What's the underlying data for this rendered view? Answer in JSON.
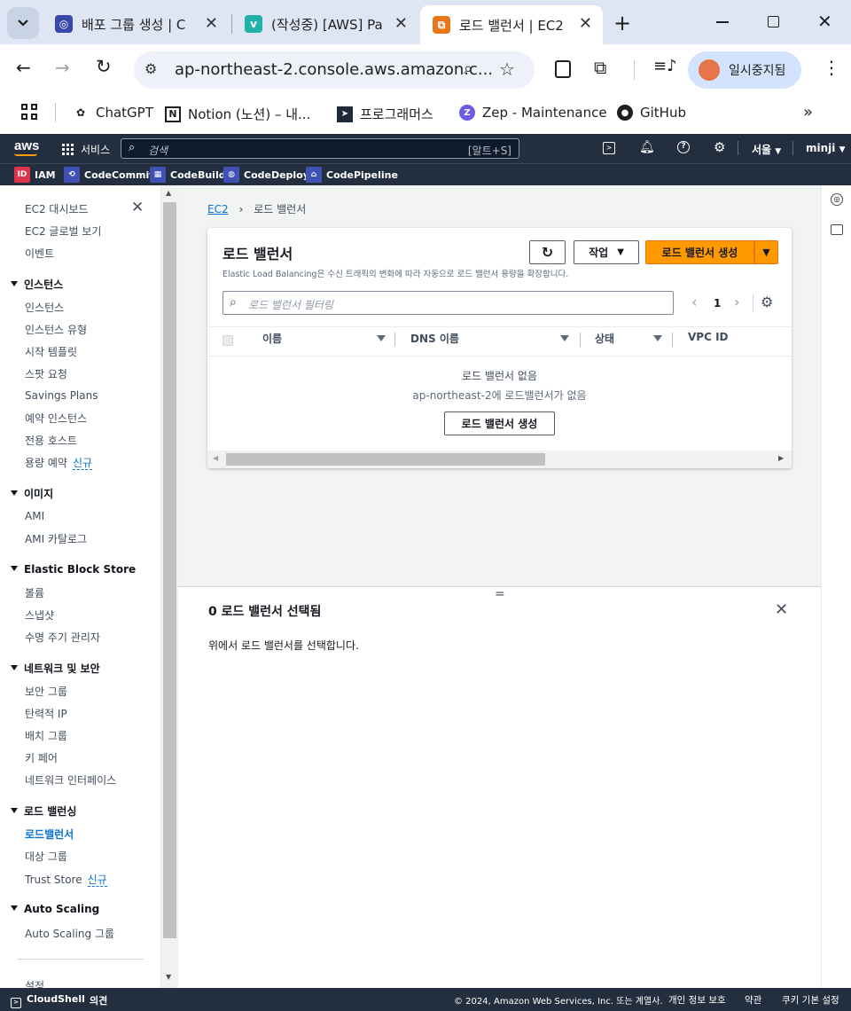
{
  "browser": {
    "tabs": [
      {
        "title": "배포 그룹 생성 | C",
        "fav_color": "#3949ab",
        "fav_text": "◎"
      },
      {
        "title": "(작성중) [AWS] Pa",
        "fav_color": "#20b2aa",
        "fav_text": "v"
      },
      {
        "title": "로드 밸런서 | EC2",
        "fav_color": "#e8761b",
        "fav_text": "⧉"
      }
    ],
    "url": "ap-northeast-2.console.aws.amazon.c...",
    "profile_label": "일시중지됨",
    "bookmarks": [
      "ChatGPT",
      "Notion (노션) – 내...",
      "프로그래머스",
      "Zep - Maintenance",
      "GitHub"
    ]
  },
  "aws_header": {
    "logo": "aws",
    "services_label": "서비스",
    "search_placeholder": "검색",
    "search_shortcut": "[알트+S]",
    "region": "서울",
    "user": "minji",
    "favorites": [
      "IAM",
      "CodeCommit",
      "CodeBuild",
      "CodeDeploy",
      "CodePipeline"
    ]
  },
  "sidebar": {
    "top_items": [
      "EC2 대시보드",
      "EC2 글로벌 보기",
      "이벤트"
    ],
    "sections": [
      {
        "title": "인스턴스",
        "items": [
          "인스턴스",
          "인스턴스 유형",
          "시작 템플릿",
          "스팟 요청",
          "Savings Plans",
          "예약 인스턴스",
          "전용 호스트",
          "용량 예약"
        ]
      },
      {
        "title": "이미지",
        "items": [
          "AMI",
          "AMI 카탈로그"
        ]
      },
      {
        "title": "Elastic Block Store",
        "items": [
          "볼륨",
          "스냅샷",
          "수명 주기 관리자"
        ]
      },
      {
        "title": "네트워크 및 보안",
        "items": [
          "보안 그룹",
          "탄력적 IP",
          "배치 그룹",
          "키 페어",
          "네트워크 인터페이스"
        ]
      },
      {
        "title": "로드 밸런싱",
        "items": [
          "로드밸런서",
          "대상 그룹",
          "Trust Store"
        ]
      },
      {
        "title": "Auto Scaling",
        "items": [
          "Auto Scaling 그룹"
        ]
      }
    ],
    "new_badge": "신규",
    "settings": "설정"
  },
  "breadcrumb": {
    "root": "EC2",
    "current": "로드 밸런서"
  },
  "panel": {
    "title": "로드 밸런서",
    "description": "Elastic Load Balancing은 수신 트래픽의 변화에 따라 자동으로 로드 밸런서 용량을 확장합니다.",
    "actions_label": "작업",
    "create_label": "로드 밸런서 생성",
    "filter_placeholder": "로드 밸런서 필터링",
    "page_number": "1",
    "columns": [
      "이름",
      "DNS 이름",
      "상태",
      "VPC ID"
    ],
    "empty_title": "로드 밸런서 없음",
    "empty_desc": "ap-northeast-2에 로드밸런서가 없음",
    "empty_button": "로드 밸런서 생성"
  },
  "split_panel": {
    "title": "0 로드 밸런서 선택됨",
    "message": "위에서 로드 밸런서를 선택합니다."
  },
  "footer": {
    "cloudshell": "CloudShell",
    "feedback": "의견",
    "copyright": "© 2024, Amazon Web Services, Inc. 또는 계열사.",
    "privacy": "개인 정보 보호",
    "terms": "약관",
    "cookies": "쿠키 기본 설정"
  },
  "colors": {
    "aws_nav": "#232f3e",
    "accent_orange": "#ff9900",
    "link_blue": "#0972d3"
  }
}
